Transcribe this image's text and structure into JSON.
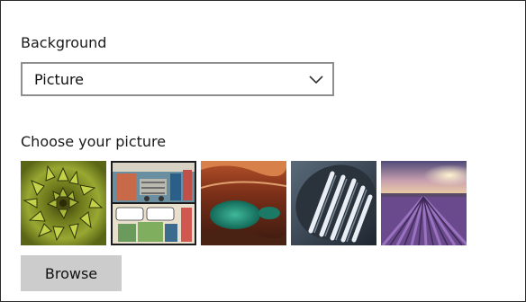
{
  "background_section": {
    "label": "Background",
    "dropdown_value": "Picture"
  },
  "picture_section": {
    "label": "Choose your picture",
    "thumbnails": [
      {
        "name": "succulent-rosette"
      },
      {
        "name": "comic-strip"
      },
      {
        "name": "canyon-pool"
      },
      {
        "name": "microphone-closeup"
      },
      {
        "name": "lavender-field-sunset"
      }
    ],
    "browse_label": "Browse"
  }
}
